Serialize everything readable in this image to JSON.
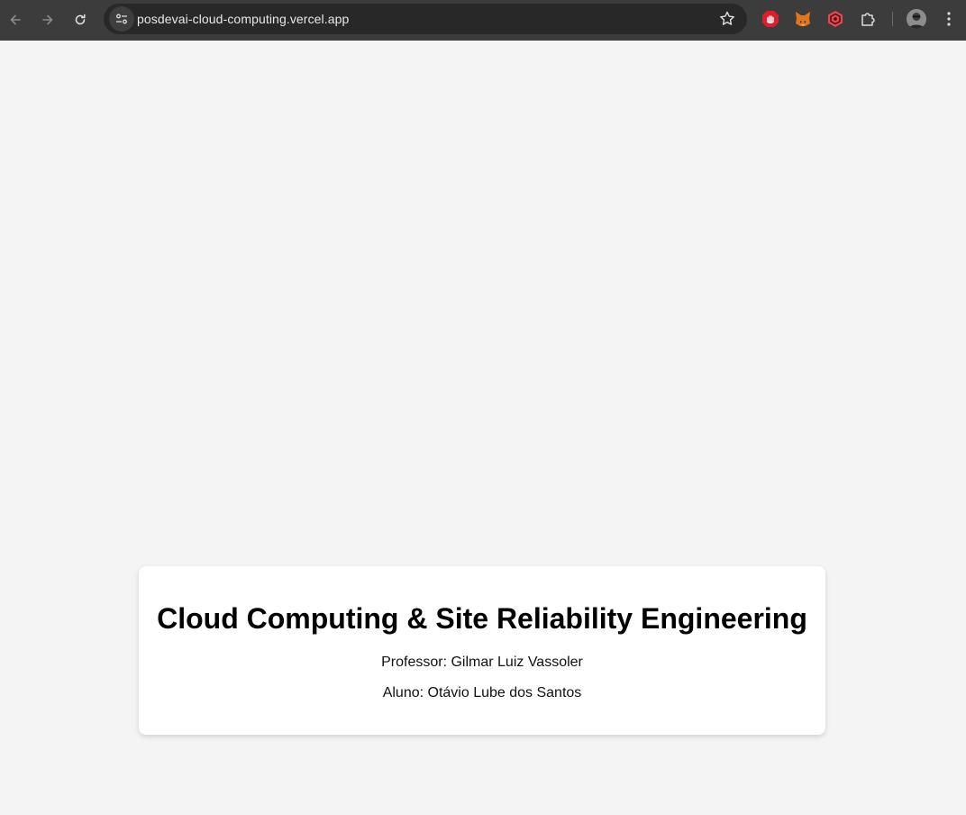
{
  "browser": {
    "url": "posdevai-cloud-computing.vercel.app",
    "icons": [
      "back-icon",
      "forward-icon",
      "reload-icon",
      "site-settings-icon",
      "bookmark-star-icon",
      "adblock-extension-icon",
      "metamask-extension-icon",
      "security-extension-icon",
      "extensions-puzzle-icon",
      "profile-avatar",
      "menu-kebab-icon"
    ]
  },
  "page": {
    "title": "Cloud Computing & Site Reliability Engineering",
    "professor": "Professor: Gilmar Luiz Vassoler",
    "student": "Aluno: Otávio Lube dos Santos"
  },
  "colors": {
    "toolbar": "#3c3c3c",
    "omnibox": "#282828",
    "page_background": "#f4f4f4",
    "card": "#ffffff"
  }
}
